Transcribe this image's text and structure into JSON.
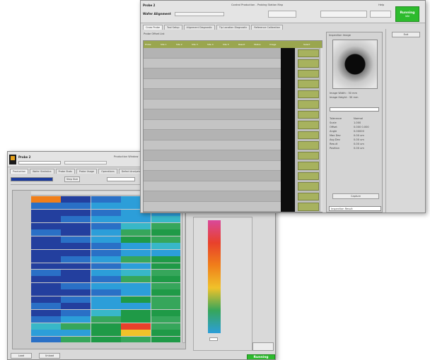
{
  "back_window": {
    "title_left": "Probe 2",
    "title_center": "Production Window",
    "step_label": "Step Size",
    "tabs": [
      "Production",
      "Wafer Statistics",
      "Probe Stats",
      "Probe Usage",
      "Operations",
      "Defect Analysis"
    ],
    "heatmap": {
      "rows": [
        [
          "#f07f1a",
          "#233f9e",
          "#2a70c6",
          "#2c9ed9",
          "#2c9ed9"
        ],
        [
          "#2a70c6",
          "#2a70c6",
          "#2c9ed9",
          "#2c9ed9",
          "#38b7c8"
        ],
        [
          "#233f9e",
          "#233f9e",
          "#2a70c6",
          "#2c9ed9",
          "#2c9ed9"
        ],
        [
          "#233f9e",
          "#2a70c6",
          "#2c9ed9",
          "#2c9ed9",
          "#38b7c8"
        ],
        [
          "#233f9e",
          "#233f9e",
          "#2a70c6",
          "#38b7c8",
          "#36a65b"
        ],
        [
          "#2a70c6",
          "#233f9e",
          "#2c9ed9",
          "#36a65b",
          "#1f9a47"
        ],
        [
          "#233f9e",
          "#2a70c6",
          "#2c9ed9",
          "#1f9a47",
          "#36a65b"
        ],
        [
          "#233f9e",
          "#233f9e",
          "#2a70c6",
          "#2c9ed9",
          "#38b7c8"
        ],
        [
          "#233f9e",
          "#233f9e",
          "#2a70c6",
          "#2c9ed9",
          "#2c9ed9"
        ],
        [
          "#233f9e",
          "#2a70c6",
          "#2c9ed9",
          "#36a65b",
          "#1f9a47"
        ],
        [
          "#233f9e",
          "#233f9e",
          "#2a70c6",
          "#2c9ed9",
          "#1f9a47"
        ],
        [
          "#2a70c6",
          "#233f9e",
          "#2c9ed9",
          "#38b7c8",
          "#36a65b"
        ],
        [
          "#233f9e",
          "#233f9e",
          "#2a70c6",
          "#36a65b",
          "#1f9a47"
        ],
        [
          "#233f9e",
          "#2a70c6",
          "#2c9ed9",
          "#2c9ed9",
          "#36a65b"
        ],
        [
          "#233f9e",
          "#233f9e",
          "#2a70c6",
          "#2c9ed9",
          "#1f9a47"
        ],
        [
          "#233f9e",
          "#2a70c6",
          "#2c9ed9",
          "#1f9a47",
          "#36a65b"
        ],
        [
          "#2a70c6",
          "#233f9e",
          "#2c9ed9",
          "#2c9ed9",
          "#36a65b"
        ],
        [
          "#233f9e",
          "#2a70c6",
          "#38b7c8",
          "#1f9a47",
          "#1f9a47"
        ],
        [
          "#2a70c6",
          "#2c9ed9",
          "#36a65b",
          "#1f9a47",
          "#36a65b"
        ],
        [
          "#38b7c8",
          "#36a65b",
          "#1f9a47",
          "#e8412b",
          "#36a65b"
        ],
        [
          "#2c9ed9",
          "#2c9ed9",
          "#1f9a47",
          "#f0c22a",
          "#1f9a47"
        ],
        [
          "#2a70c6",
          "#36a65b",
          "#1f9a47",
          "#36a65b",
          "#1f9a47"
        ]
      ]
    },
    "colorbar_stops": [
      "#d9489a",
      "#e8412b",
      "#f07f1a",
      "#f0c22a",
      "#36a65b",
      "#2c9ed9"
    ],
    "status_button": "Running",
    "bottom_btn_1": "Load",
    "bottom_btn_2": "Unload"
  },
  "front_window": {
    "title_left": "Probe 2",
    "title_center": "Control Production - Probing Station Map",
    "title_right": "Help",
    "sub_title": "Wafer Alignment",
    "status_button": "Running",
    "status_sub": "Idle",
    "tabs": [
      "Cross Probe",
      "Tool Setup",
      "Alignment Diagnostic",
      "Tip Location Diagnostic",
      "Reference Calibration"
    ],
    "table_label": "Probe Offset List",
    "columns": [
      "Probe",
      "Site 1",
      "Site 2",
      "Site 3",
      "Site 4",
      "Site 5",
      "Result",
      "Status",
      "Image",
      "Select"
    ],
    "right_panel_title": "Inspection Image",
    "info_rows": [
      "Image Width  : 30 mm",
      "Image Height : 30 mm"
    ],
    "stat_labels": [
      "Tolerance",
      "Scale",
      "Offset",
      "Angle",
      "Max Dev",
      "Avg Dev",
      "Result",
      "Position"
    ],
    "stat_values": [
      "Normal",
      "1.000",
      "0.000 0.000",
      "0.00000",
      "0.00 um",
      "0.00 um",
      "0.00 um",
      "0.00 um"
    ],
    "capture_btn": "Capture",
    "bottom_field": "Inspection Result",
    "side_btn": "Exit"
  }
}
